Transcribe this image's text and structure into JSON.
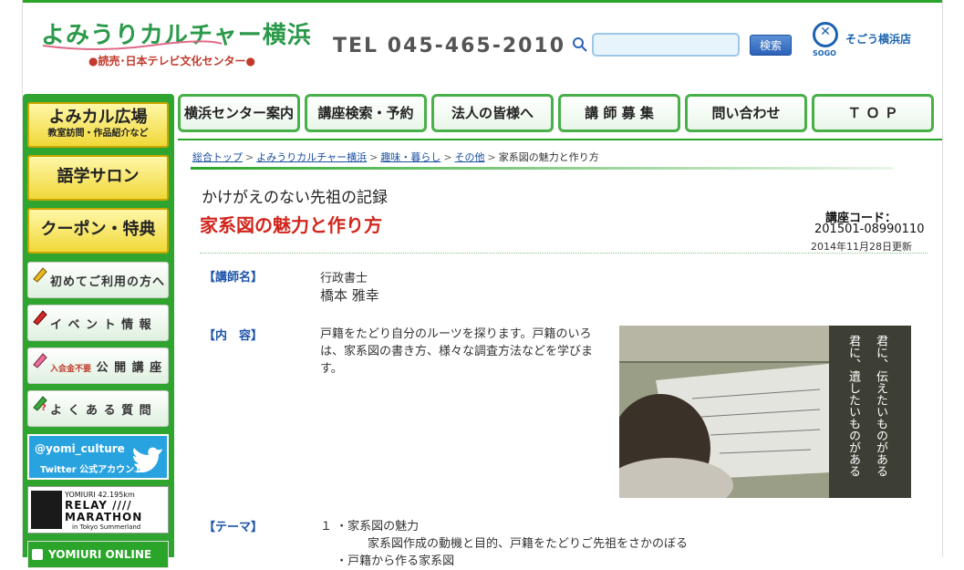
{
  "header": {
    "logo_main": "よみうりカルチャー横浜",
    "logo_sub": "●読売･日本テレビ文化センター●",
    "tel": "TEL 045-465-2010",
    "search_placeholder": "",
    "search_button": "検索",
    "sogo_label": "そごう横浜店",
    "sogo_small": "SOGO"
  },
  "nav": {
    "tabs": [
      {
        "label": "横浜センター案内"
      },
      {
        "label": "講座検索・予約"
      },
      {
        "label": "法人の皆様へ"
      },
      {
        "label": "講 師 募 集"
      },
      {
        "label": "問い合わせ"
      },
      {
        "label": "Ｔ Ｏ Ｐ"
      }
    ]
  },
  "sidebar": {
    "big1_title": "よみカル広場",
    "big1_sub": "教室訪問・作品紹介など",
    "big2_title": "語学サロン",
    "big3_title": "クーポン・特典",
    "link1": "初めてご利用の方へ",
    "link2": "イ ベ ン ト 情 報",
    "link3_small": "入会金不要",
    "link3": "公 開 講 座",
    "link4": "よ く あ る 質 問",
    "twitter_handle": "@yomi_culture",
    "twitter_sub": "Twitter 公式アカウント",
    "marathon_l1": "YOMIURI  42.195km",
    "marathon_l2": "RELAY ////",
    "marathon_l3": "MARATHON",
    "marathon_l4": "in Tokyo Summerland",
    "yomiuri_online": "YOMIURI ONLINE"
  },
  "breadcrumb": {
    "items": [
      "総合トップ",
      "よみうりカルチャー横浜",
      "趣味・暮らし",
      "その他"
    ],
    "current": "家系図の魅力と作り方",
    "sep": ">"
  },
  "course": {
    "subtitle": "かけがえのない先祖の記録",
    "title": "家系図の魅力と作り方",
    "code_label": "講座コード：",
    "code_value": "201501-08990110",
    "updated": "2014年11月28日更新",
    "instructor_label": "【講師名】",
    "instructor_role": "行政書士",
    "instructor_name": "橋本 雅幸",
    "content_label": "【内　容】",
    "content_text": "戸籍をたどり自分のルーツを探ります。戸籍のいろは、家系図の書き方、様々な調査方法などを学びます。",
    "photo_caption_1": "君に、伝えたいものがある",
    "photo_caption_2": "君に、遺したいものがある",
    "theme_label": "【テーマ】",
    "theme_1": "１ ・家系図の魅力",
    "theme_1_detail": "家系図作成の動機と目的、戸籍をたどりご先祖をさかのぼる",
    "theme_2": "　 ・戸籍から作る家系図"
  },
  "colors": {
    "brand_green": "#2aa52a",
    "title_red": "#d2261d",
    "label_blue": "#1c53a8"
  }
}
